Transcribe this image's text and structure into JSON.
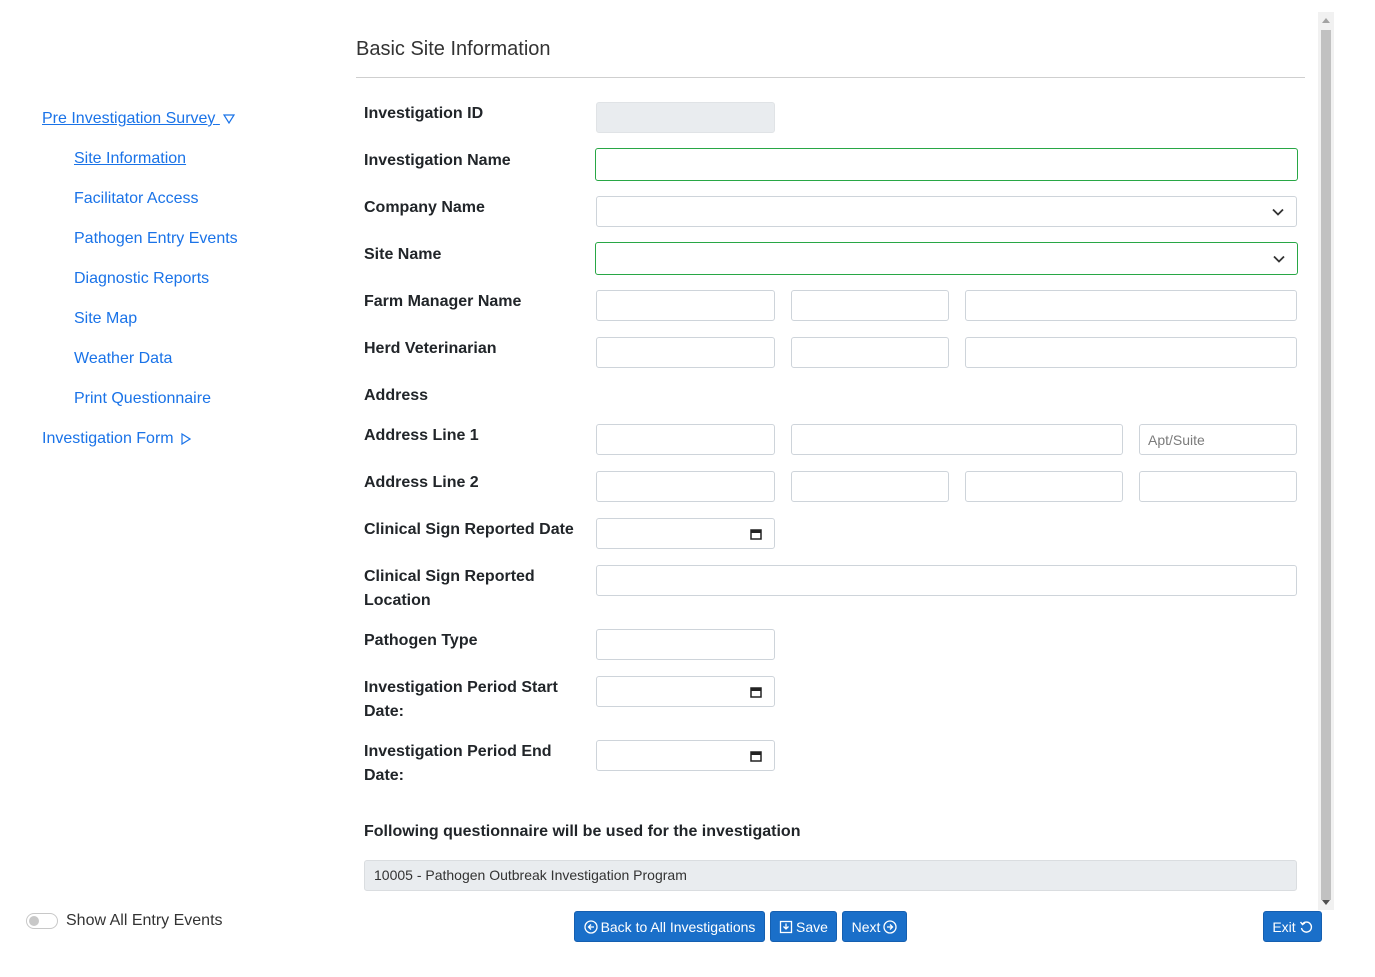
{
  "sidebar": {
    "pre_investigation": "Pre Investigation Survey",
    "items": [
      {
        "label": "Site Information"
      },
      {
        "label": "Facilitator Access"
      },
      {
        "label": "Pathogen Entry Events"
      },
      {
        "label": "Diagnostic Reports"
      },
      {
        "label": "Site Map"
      },
      {
        "label": "Weather Data"
      },
      {
        "label": "Print Questionnaire"
      }
    ],
    "investigation_form": "Investigation Form",
    "toggle_label": "Show All Entry Events"
  },
  "form": {
    "title": "Basic Site Information",
    "labels": {
      "investigation_id": "Investigation ID",
      "investigation_name": "Investigation Name",
      "company_name": "Company Name",
      "site_name": "Site Name",
      "farm_manager_name": "Farm Manager Name",
      "herd_veterinarian": "Herd Veterinarian",
      "address": "Address",
      "address_line_1": "Address Line 1",
      "address_line_2": "Address Line 2",
      "clinical_sign_date": "Clinical Sign Reported Date",
      "clinical_sign_location_1": "Clinical Sign Reported",
      "clinical_sign_location_2": "Location",
      "pathogen_type": "Pathogen Type",
      "period_start_1": "Investigation Period Start",
      "period_start_2": "Date:",
      "period_end_1": "Investigation Period End",
      "period_end_2": "Date:",
      "questionnaire": "Following questionnaire will be used for the investigation"
    },
    "placeholders": {
      "apt_suite": "Apt/Suite"
    },
    "questionnaire_value": "10005 - Pathogen Outbreak Investigation Program"
  },
  "buttons": {
    "back": "Back to All Investigations",
    "save": "Save",
    "next": "Next",
    "exit": "Exit"
  },
  "colors": {
    "link": "#1a73e8",
    "primary": "#1a6fc9",
    "valid_border": "#28a745"
  }
}
